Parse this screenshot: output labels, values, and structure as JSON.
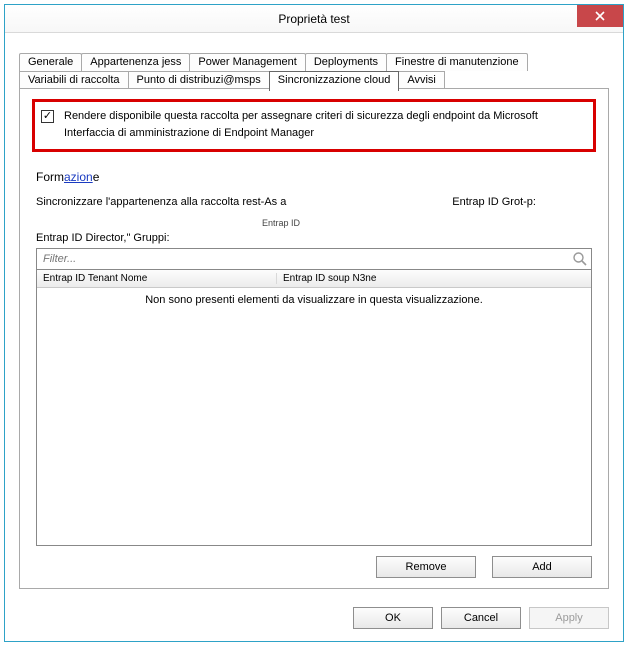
{
  "window": {
    "title": "Proprietà test"
  },
  "tabs": {
    "row1": [
      "Generale",
      "Appartenenza jess",
      "Power Management",
      "Deployments",
      "Finestre di manutenzione"
    ],
    "row2": [
      "Variabili di raccolta",
      "Punto di distribuzi@msps",
      "Sincronizzazione cloud",
      "Avvisi"
    ],
    "selected": "Sincronizzazione cloud"
  },
  "highlight": {
    "checked": true,
    "line1": "Rendere disponibile questa raccolta per assegnare criteri di sicurezza degli endpoint da Microsoft",
    "line2": "Interfaccia di amministrazione di Endpoint Manager"
  },
  "section": {
    "heading_prefix": "Form",
    "heading_link": "azion",
    "heading_suffix": "e",
    "sync_label": "Sincronizzare l'appartenenza alla raccolta rest-As a",
    "sync_value": "Entrap ID Grot-p:",
    "hint": "Entrap ID",
    "groups_label": "Entrap ID Director,\" Gruppi:"
  },
  "filter": {
    "placeholder": "Filter..."
  },
  "columns": {
    "c1": "Entrap ID Tenant Nome",
    "c2": "Entrap ID soup N3ne"
  },
  "empty_text": "Non sono presenti elementi da visualizzare in questa visualizzazione.",
  "buttons": {
    "remove": "Remove",
    "add": "Add",
    "ok": "OK",
    "cancel": "Cancel",
    "apply": "Apply"
  }
}
